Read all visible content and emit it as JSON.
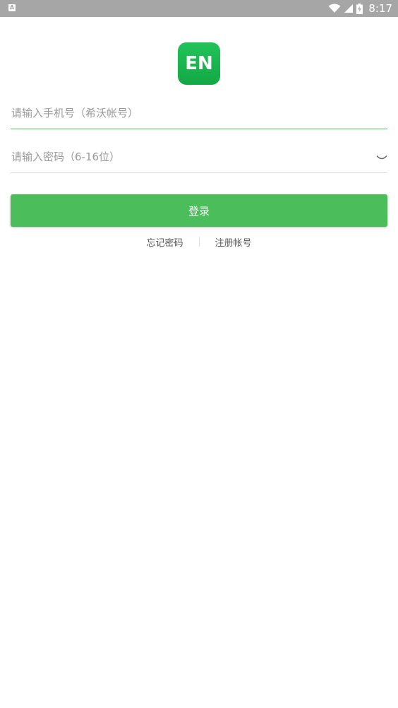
{
  "status_bar": {
    "notification_icon": "a-icon",
    "wifi_icon": "wifi-icon",
    "signal_icon": "signal-icon",
    "battery_icon": "battery-charging-icon",
    "time": "8:17"
  },
  "logo": {
    "text": "EN",
    "color": "#1cb852"
  },
  "form": {
    "phone_placeholder": "请输入手机号（希沃帐号）",
    "password_placeholder": "请输入密码（6-16位）",
    "eye_icon": "eye-closed-icon",
    "login_label": "登录",
    "accent_color": "#4bbd5a"
  },
  "links": {
    "forgot_password": "忘记密码",
    "register": "注册帐号"
  }
}
